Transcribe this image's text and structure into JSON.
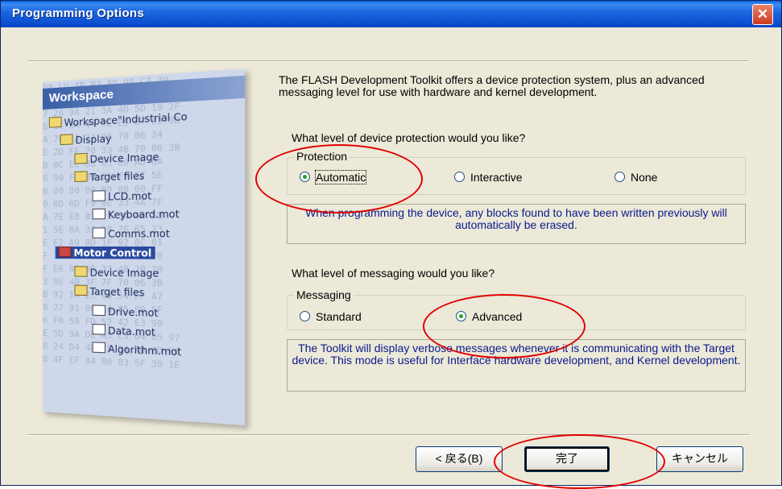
{
  "window": {
    "title": "Programming Options",
    "close_label": "✕"
  },
  "description": "The FLASH Development Toolkit offers a device protection system, plus an advanced messaging level for use with hardware and kernel development.",
  "protection": {
    "question": "What level of device protection would you like?",
    "group_label": "Protection",
    "options": [
      "Automatic",
      "Interactive",
      "None"
    ],
    "selected": "Automatic",
    "info": "When programming the device, any blocks found to have been written previously will automatically be erased."
  },
  "messaging": {
    "question": "What level of messaging would you like?",
    "group_label": "Messaging",
    "options": [
      "Standard",
      "Advanced"
    ],
    "selected": "Advanced",
    "info": "The Toolkit will display verbose messages whenever it is communicating with the Target device. This mode is useful for Interface hardware development, and Kernel development."
  },
  "buttons": {
    "back": "< 戻る(B)",
    "finish": "完了",
    "cancel": "キャンセル"
  },
  "illustration": {
    "header": "Workspace",
    "tree": [
      "Workspace\"Industrial Co",
      "Display",
      "Device Image",
      "Target files",
      "LCD.mot",
      "Keyboard.mot",
      "Comms.mot",
      "Motor Control",
      "Device Image",
      "Target files",
      "Drive.mot",
      "Data.mot",
      "Algorithm.mot"
    ],
    "hex_background": "D8 LU 4B B3 8D 9B C7 39\nC2 7F 4D 2D 48 DA FF 5B\n7 2A 9A 21 3A 4D 5D 19 2F\nB 1C 8A 44 9E E5 67 02 8B\nA 7F 13 21 9A 70 06 34\nE 2D FF 70 33 4B 70 06 3B\nB 0C EC 8B 05 00 AD BA\n0 00 FB 8D 21 FF 77 5E\n0 00 00 00 00 00 00 FF\n0 0D 6D F9 9E 33 4A 7F\nA 7E E8 B1 21 3A 4D 5D\n1 5E 8A 33 19 2F 65 23\nE E2 A9 0D 1F 92 8C 01\nF 7E 6D FF 70 33 4B 70\nF E6 80 6B 33 4B 2B 70\n3 8E 4B 3F 7F 70 06 3B\nB 92 1A 2C 6B 54 FF A7\n8 27 91 08 14 85 00 FF\n6 F0 58 FD 52 42 E3 90\nE 5D 9A DE A5 C5 64 85 97\n8 24 D4 4D 75 54 AD 2D F6\n8 4F EF 84 B0 83 5F 30 1E"
  },
  "colors": {
    "annotation": "#e00000",
    "title_bar": "#0b4fd0",
    "info_text": "#0a1a8c"
  }
}
